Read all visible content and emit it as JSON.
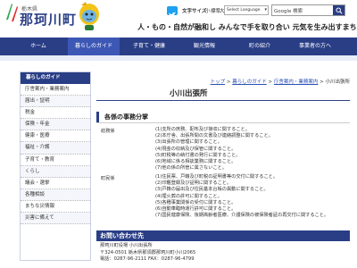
{
  "header": {
    "pref": "栃木県",
    "town": "那珂川町",
    "textsize_label": "文字サイズ",
    "size_small": "小",
    "size_standard": "標準",
    "size_large": "大",
    "language_select": "Select Language",
    "search_placeholder": "Google 検索",
    "search_icon": "search-icon",
    "tagline": "人・もの・自然が融和し みんなで手を取り合い 元気を生み出すまち",
    "brand_color": "#2a3e86"
  },
  "nav": {
    "items": [
      "ホーム",
      "暮らしのガイド",
      "子育て・健康",
      "観光情報",
      "町の紹介",
      "事業者の方へ"
    ]
  },
  "sidebar": {
    "title": "暮らしのガイド",
    "items": [
      "庁舎案内・業務案内",
      "届出・証明",
      "税金",
      "保険・年金",
      "健康・医療",
      "福祉・介護",
      "子育て・教育",
      "くらし",
      "議会・選挙",
      "各種相談",
      "まちな災情報",
      "災害に備えて"
    ]
  },
  "breadcrumb": {
    "items": [
      "トップ",
      "暮らしのガイド",
      "庁舎案内・業務案内"
    ],
    "current": "小川出張所",
    "separator": ">"
  },
  "page": {
    "title": "小川出張所",
    "section_title": "各係の事務分掌"
  },
  "duties": {
    "dept1": "総務係",
    "dept1_items": [
      "(1)支所の庶務、配布及び接収に関すること。",
      "(2)本庁舎、出張所間の文書及び連絡調整に関すること。",
      "(3)出張所の管理に関すること。",
      "(4)現金の収納及び保管に関すること。",
      "(5)町税等の納付書の発行に関すること。",
      "(6)地域に係る相談業務に関すること。",
      "(7)他の係の所管に属さないこと。"
    ],
    "dept2": "町民係",
    "dept2_items": [
      "(1)住民票、戸籍及び町税の証明書等の交付に関すること。",
      "(2)印鑑登録及び証明に関すること。",
      "(3)戸籍の届出及び住民基本台帳の異動に関すること。",
      "(4)埋火葬の許可に関すること。",
      "(5)各種事業関係の受付に関すること。",
      "(6)自動車臨時運行許可に関すること。",
      "(7)国民健康保険、後期高齢者医療、介護保険の被保険者証の再交付に関すること。"
    ]
  },
  "contact": {
    "title": "お問い合わせ先",
    "line1": "那珂川町役場 小川出張所",
    "line2": "〒324-0501 栃木県那須郡那珂川町小川2065",
    "line3_label": "電話：",
    "tel": "0287-96-2111",
    "fax_label": " FAX：",
    "fax": "0287-96-4799"
  }
}
